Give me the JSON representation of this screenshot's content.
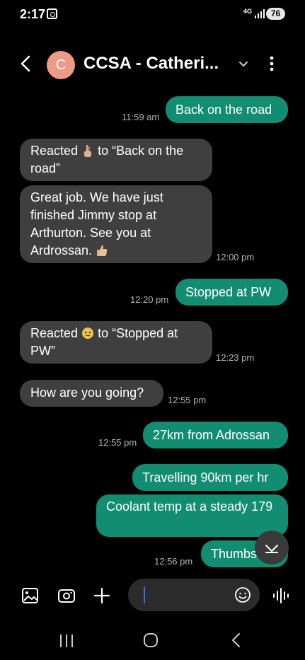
{
  "status_bar": {
    "time": "2:17",
    "network": "4G",
    "battery": "76"
  },
  "header": {
    "avatar_letter": "C",
    "title": "CCSA - Catheri...",
    "avatar_color": "#ee9a86"
  },
  "messages": [
    {
      "side": "out",
      "text": "Back on the road",
      "time": "11:59 am"
    },
    {
      "side": "in",
      "text": "Reacted • to “Back on the road”",
      "reaction_prefix": "Reacted",
      "reaction_text": "to “Back on the road”",
      "emoji": "crossed-fingers"
    },
    {
      "side": "in",
      "text": "Great job. We have just finished Jimmy stop at Arthurton. See you at Ardrossan.",
      "emoji": "thumbs-up",
      "time": "12:00 pm"
    },
    {
      "side": "out",
      "text": "Stopped at PW",
      "time": "12:20 pm"
    },
    {
      "side": "in",
      "reaction_prefix": "Reacted",
      "reaction_text": "to “Stopped at PW”",
      "emoji": "sad-face",
      "time": "12:23 pm"
    },
    {
      "side": "in",
      "text": "How are you going?",
      "time": "12:55 pm"
    },
    {
      "side": "out",
      "text": "27km from Adrossan",
      "time": "12:55 pm"
    },
    {
      "side": "out",
      "text": "Travelling 90km per hr"
    },
    {
      "side": "out",
      "text": "Coolant temp at a steady 179"
    },
    {
      "side": "out",
      "text": "Thumbs",
      "time": "12:56 pm"
    }
  ],
  "colors": {
    "outgoing": "#138d72",
    "incoming": "#3f3f3f",
    "background": "#000000"
  },
  "input": {
    "placeholder": ""
  }
}
